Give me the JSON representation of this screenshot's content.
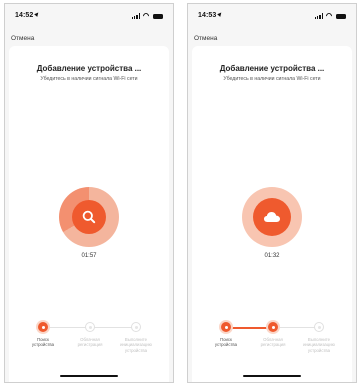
{
  "screens": [
    {
      "status_time": "14:52",
      "cancel_label": "Отмена",
      "title": "Добавление устройства ...",
      "subtitle": "Убедитесь в наличии сигнала Wi-Fi сети",
      "center_icon": "search-icon",
      "timer": "01:57",
      "steps": [
        {
          "label": "Поиск устройства",
          "state": "active"
        },
        {
          "label": "Облачная регистрация",
          "state": "pending"
        },
        {
          "label": "Выполните инициализацию устройства",
          "state": "pending"
        }
      ]
    },
    {
      "status_time": "14:53",
      "cancel_label": "Отмена",
      "title": "Добавление устройства ...",
      "subtitle": "Убедитесь в наличии сигнала Wi-Fi сети",
      "center_icon": "cloud-icon",
      "timer": "01:32",
      "steps": [
        {
          "label": "Поиск устройства",
          "state": "active"
        },
        {
          "label": "Облачная регистрация",
          "state": "active"
        },
        {
          "label": "Выполните инициализацию устройства",
          "state": "pending"
        }
      ]
    }
  ],
  "colors": {
    "accent": "#ef5a2e",
    "accent_light": "#f4b59d",
    "background": "#f6f6f6"
  }
}
